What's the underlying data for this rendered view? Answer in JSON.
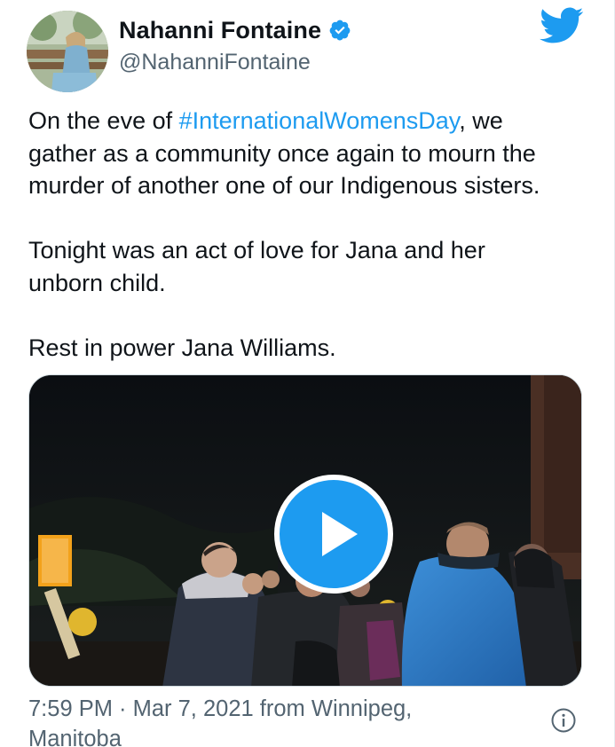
{
  "tweet": {
    "author": {
      "display_name": "Nahanni Fontaine",
      "handle": "@NahanniFontaine",
      "verified": true,
      "avatar_icon": "profile-photo"
    },
    "text": {
      "line1_prefix": "On the eve of ",
      "hashtag": "#InternationalWomensDay",
      "line1_suffix": ", we",
      "line2": "gather as a community once again to mourn the",
      "line3": "murder of another one of our Indigenous sisters.",
      "line4": "Tonight was an act of love for Jana and her",
      "line5": "unborn child.",
      "line6": "Rest in power Jana Williams."
    },
    "media": {
      "type": "video",
      "play_icon": "play-icon"
    },
    "meta": {
      "line1": "7:59 PM · Mar 7, 2021 from Winnipeg,",
      "line2": "Manitoba"
    }
  },
  "icons": {
    "brand": "twitter-bird-icon",
    "verified": "verified-badge-icon",
    "info": "info-icon"
  },
  "colors": {
    "accent": "#1d9bf0",
    "text": "#0f1419",
    "secondary": "#536471",
    "border": "#cfd9de"
  }
}
